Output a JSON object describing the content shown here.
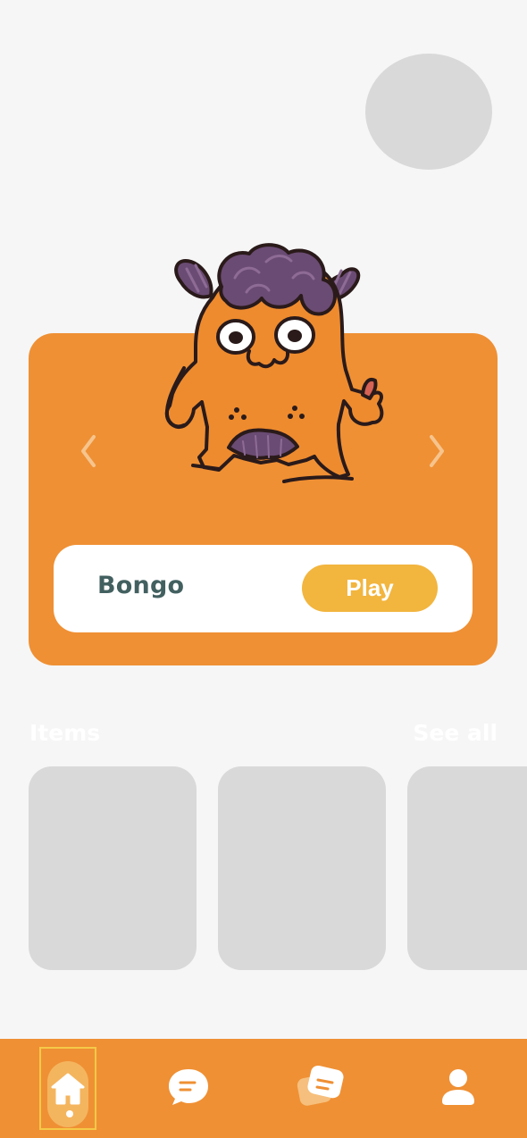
{
  "hero": {
    "character_name": "Bongo",
    "play_label": "Play"
  },
  "items": {
    "title": "Items",
    "see_all_label": "See all",
    "cards": [
      "",
      "",
      ""
    ]
  },
  "nav": {
    "items": [
      {
        "name": "home",
        "icon": "home-icon",
        "active": true
      },
      {
        "name": "chat",
        "icon": "chat-bubble-icon",
        "active": false
      },
      {
        "name": "notes",
        "icon": "notes-icon",
        "active": false
      },
      {
        "name": "profile",
        "icon": "profile-icon",
        "active": false
      }
    ]
  },
  "colors": {
    "background": "#f6f6f6",
    "accent": "#ef9034",
    "play_button": "#f2b53e",
    "text_dark": "#42605f",
    "placeholder": "#d9d9d9"
  }
}
